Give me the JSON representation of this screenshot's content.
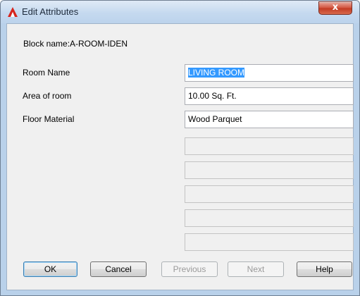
{
  "window": {
    "title": "Edit Attributes",
    "close_glyph": "x"
  },
  "block": {
    "label": "Block name:",
    "value": "A-ROOM-IDEN"
  },
  "attributes": [
    {
      "label": "Room Name",
      "value": "LIVING ROOM"
    },
    {
      "label": "Area of room",
      "value": "10.00 Sq. Ft."
    },
    {
      "label": "Floor Material",
      "value": "Wood Parquet"
    }
  ],
  "buttons": {
    "ok": "OK",
    "cancel": "Cancel",
    "previous": "Previous",
    "next": "Next",
    "help": "Help"
  },
  "colors": {
    "app_icon_red": "#d7261e",
    "selection": "#3399ff"
  },
  "icons": {
    "app": "autocad-a-icon",
    "close": "close-icon"
  }
}
